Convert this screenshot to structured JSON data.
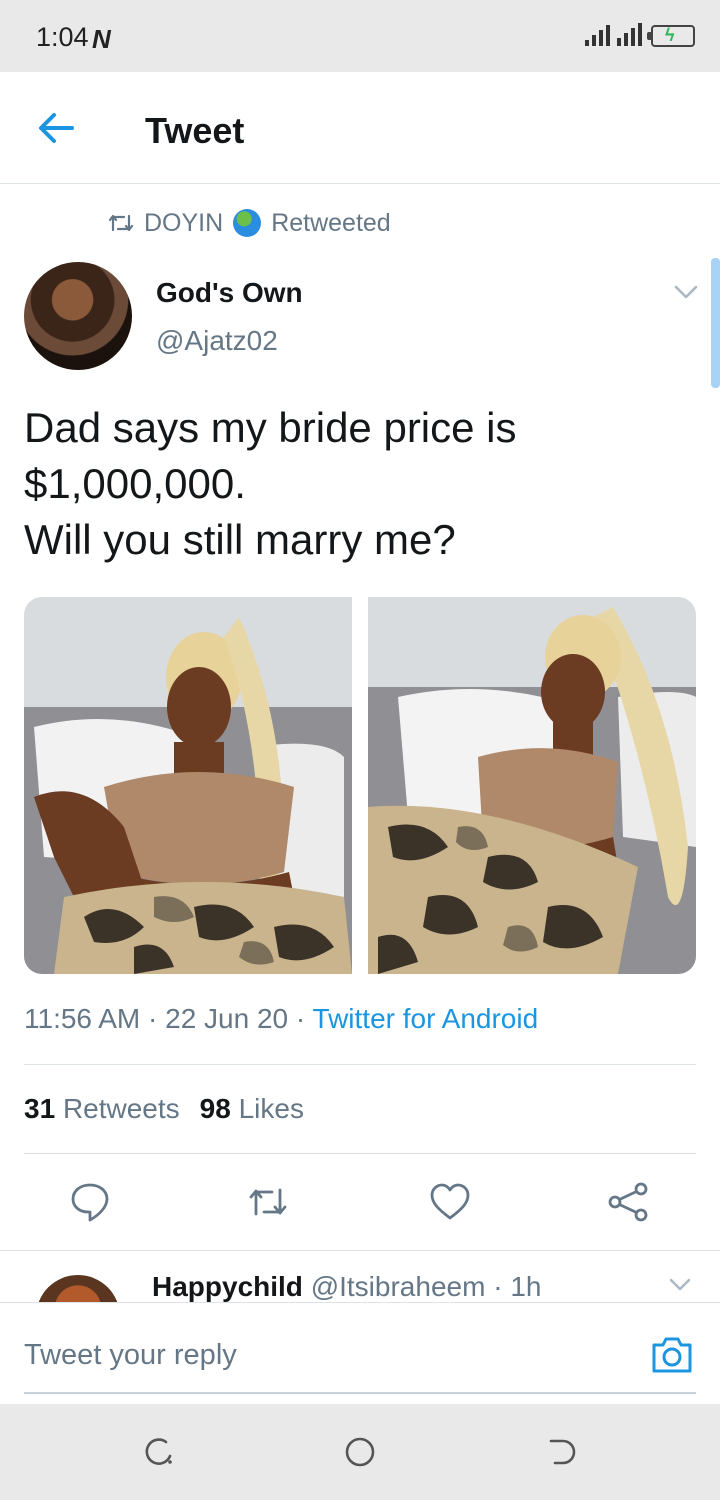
{
  "status_bar": {
    "time": "1:04",
    "network_icon": "n-icon"
  },
  "header": {
    "back_icon": "back-arrow-icon",
    "title": "Tweet"
  },
  "retweet_context": {
    "user": "DOYIN",
    "label": "Retweeted",
    "icons": [
      "retweet-icon",
      "globe-icon"
    ]
  },
  "tweet": {
    "author_name": "God's Own",
    "author_handle": "@Ajatz02",
    "text_lines": [
      "Dad says my bride price is",
      "$1,000,000.",
      "Will you still marry me?"
    ],
    "time": "11:56 AM",
    "date": "22 Jun 20",
    "source": "Twitter for Android",
    "retweets_count": "31",
    "retweets_label": "Retweets",
    "likes_count": "98",
    "likes_label": "Likes"
  },
  "actions": [
    "reply-icon",
    "retweet-icon",
    "like-icon",
    "share-icon"
  ],
  "reply_preview": {
    "name": "Happychild",
    "handle": "@Itsibraheem",
    "age": "1h"
  },
  "reply_box": {
    "placeholder": "Tweet your reply",
    "icon": "camera-icon"
  },
  "nav_bar": {
    "icons": [
      "recents-icon",
      "home-icon",
      "back-icon"
    ]
  },
  "colors": {
    "accent": "#1b95e0",
    "secondary_text": "#657786",
    "text": "#14171a"
  }
}
